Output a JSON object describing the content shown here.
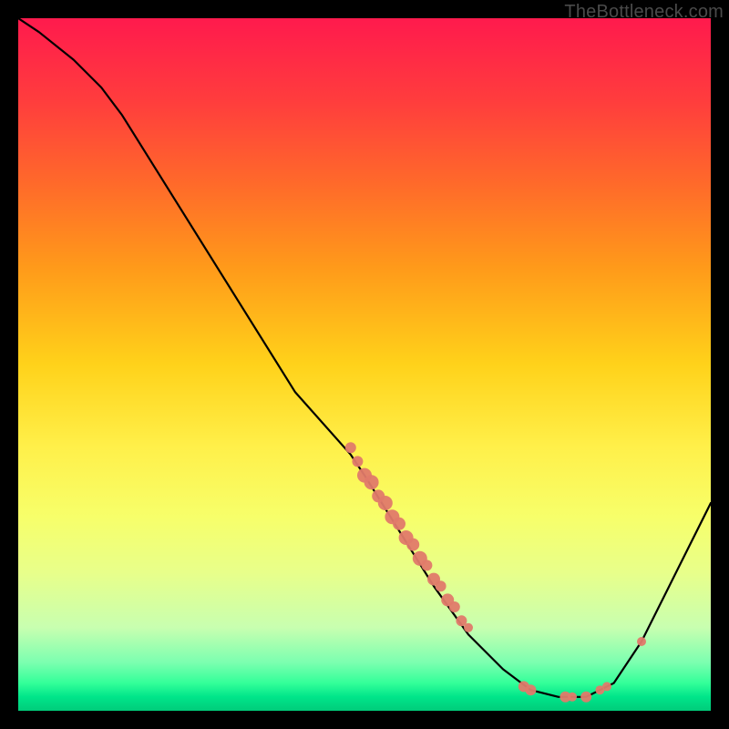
{
  "watermark": "TheBottleneck.com",
  "chart_data": {
    "type": "line",
    "title": "",
    "xlabel": "",
    "ylabel": "",
    "xlim": [
      0,
      100
    ],
    "ylim": [
      0,
      100
    ],
    "curve": [
      {
        "x": 0,
        "y": 100
      },
      {
        "x": 3,
        "y": 98
      },
      {
        "x": 8,
        "y": 94
      },
      {
        "x": 12,
        "y": 90
      },
      {
        "x": 15,
        "y": 86
      },
      {
        "x": 20,
        "y": 78
      },
      {
        "x": 30,
        "y": 62
      },
      {
        "x": 40,
        "y": 46
      },
      {
        "x": 48,
        "y": 37
      },
      {
        "x": 50,
        "y": 34
      },
      {
        "x": 55,
        "y": 26
      },
      {
        "x": 60,
        "y": 18
      },
      {
        "x": 65,
        "y": 11
      },
      {
        "x": 70,
        "y": 6
      },
      {
        "x": 74,
        "y": 3
      },
      {
        "x": 78,
        "y": 2
      },
      {
        "x": 82,
        "y": 2
      },
      {
        "x": 86,
        "y": 4
      },
      {
        "x": 90,
        "y": 10
      },
      {
        "x": 94,
        "y": 18
      },
      {
        "x": 100,
        "y": 30
      }
    ],
    "mid_cluster_points": [
      {
        "x": 48,
        "y": 38,
        "r": 6
      },
      {
        "x": 49,
        "y": 36,
        "r": 6
      },
      {
        "x": 50,
        "y": 34,
        "r": 8
      },
      {
        "x": 51,
        "y": 33,
        "r": 8
      },
      {
        "x": 52,
        "y": 31,
        "r": 7
      },
      {
        "x": 53,
        "y": 30,
        "r": 8
      },
      {
        "x": 54,
        "y": 28,
        "r": 8
      },
      {
        "x": 55,
        "y": 27,
        "r": 7
      },
      {
        "x": 56,
        "y": 25,
        "r": 8
      },
      {
        "x": 57,
        "y": 24,
        "r": 7
      },
      {
        "x": 58,
        "y": 22,
        "r": 8
      },
      {
        "x": 59,
        "y": 21,
        "r": 6
      },
      {
        "x": 60,
        "y": 19,
        "r": 7
      },
      {
        "x": 61,
        "y": 18,
        "r": 6
      },
      {
        "x": 62,
        "y": 16,
        "r": 7
      },
      {
        "x": 63,
        "y": 15,
        "r": 6
      },
      {
        "x": 64,
        "y": 13,
        "r": 6
      },
      {
        "x": 65,
        "y": 12,
        "r": 5
      }
    ],
    "bottom_points": [
      {
        "x": 73,
        "y": 3.5,
        "r": 6
      },
      {
        "x": 74,
        "y": 3,
        "r": 6
      },
      {
        "x": 79,
        "y": 2,
        "r": 6
      },
      {
        "x": 80,
        "y": 2,
        "r": 5
      },
      {
        "x": 82,
        "y": 2,
        "r": 6
      },
      {
        "x": 84,
        "y": 3,
        "r": 5
      },
      {
        "x": 85,
        "y": 3.5,
        "r": 5
      },
      {
        "x": 90,
        "y": 10,
        "r": 5
      }
    ]
  }
}
